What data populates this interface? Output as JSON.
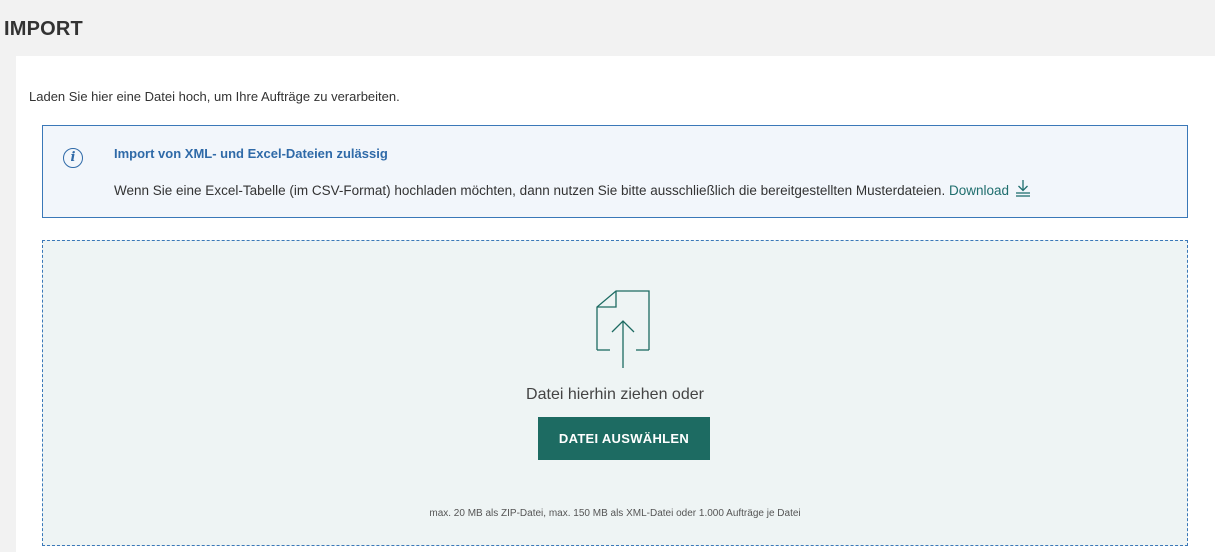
{
  "header": {
    "title": "IMPORT"
  },
  "intro": {
    "text": "Laden Sie hier eine Datei hoch, um Ihre Aufträge zu verarbeiten."
  },
  "info_box": {
    "icon": "info-icon",
    "icon_glyph": "i",
    "title": "Import von XML- und Excel-Dateien zulässig",
    "body": "Wenn Sie eine Excel-Tabelle (im CSV-Format) hochladen möchten, dann nutzen Sie bitte ausschließlich die bereitgestellten Musterdateien.",
    "download_label": "Download"
  },
  "dropzone": {
    "icon": "file-upload-icon",
    "drop_text": "Datei hierhin ziehen oder",
    "button_label": "DATEI AUSWÄHLEN",
    "limits": "max. 20 MB als ZIP-Datei, max. 150 MB als XML-Datei oder 1.000 Aufträge je Datei"
  },
  "colors": {
    "accent": "#1d6b62",
    "info_blue": "#2f6aa8",
    "border_blue": "#3a78b8",
    "background": "#f2f2f2"
  }
}
